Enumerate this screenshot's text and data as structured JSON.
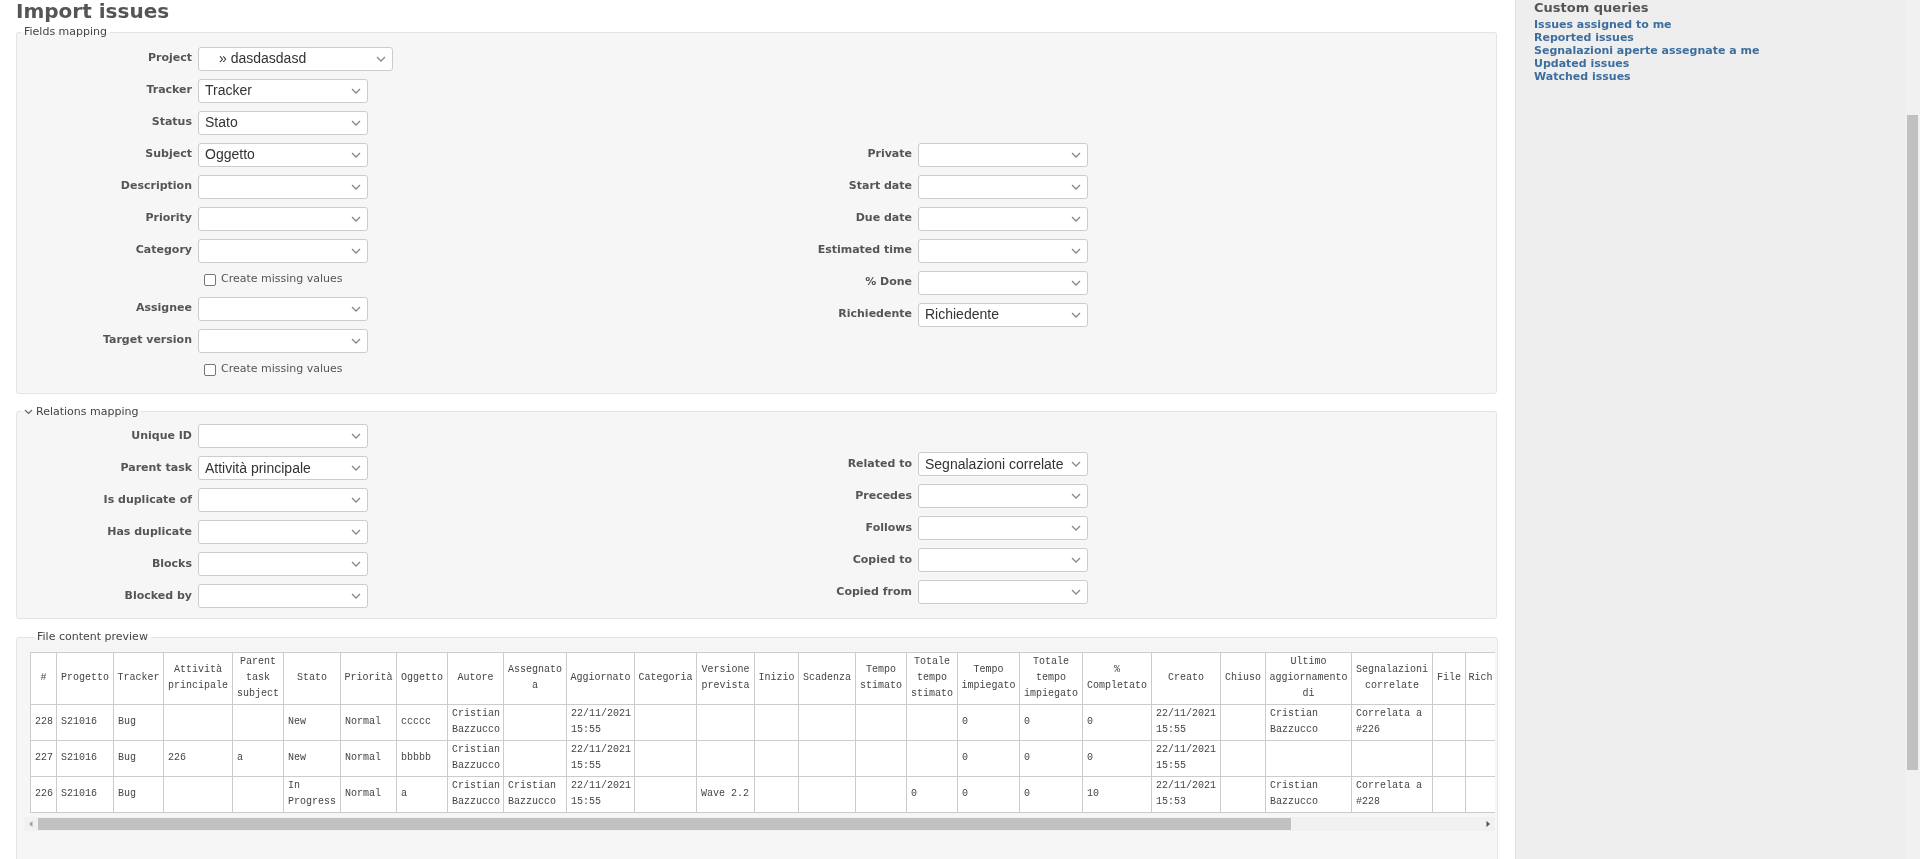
{
  "page_title": "Import issues",
  "fields_mapping": {
    "legend": "Fields mapping",
    "left": [
      {
        "kind": "select",
        "label": "Project",
        "value": "» dasdasdasd"
      },
      {
        "kind": "select",
        "label": "Tracker",
        "value": "Tracker"
      },
      {
        "kind": "select",
        "label": "Status",
        "value": "Stato"
      },
      {
        "kind": "select",
        "label": "Subject",
        "value": "Oggetto"
      },
      {
        "kind": "select",
        "label": "Description"
      },
      {
        "kind": "select",
        "label": "Priority"
      },
      {
        "kind": "select",
        "label": "Category"
      },
      {
        "kind": "checkbox",
        "label": "Create missing values",
        "checked": false
      },
      {
        "kind": "select",
        "label": "Assignee"
      },
      {
        "kind": "select",
        "label": "Target version"
      },
      {
        "kind": "checkbox",
        "label": "Create missing values",
        "checked": false
      }
    ],
    "right": [
      {
        "kind": "select",
        "label": "Private"
      },
      {
        "kind": "select",
        "label": "Start date"
      },
      {
        "kind": "select",
        "label": "Due date"
      },
      {
        "kind": "select",
        "label": "Estimated time"
      },
      {
        "kind": "select",
        "label": "% Done"
      },
      {
        "kind": "select",
        "label": "Richiedente",
        "value": "Richiedente"
      }
    ]
  },
  "relations_mapping": {
    "legend": "Relations mapping",
    "expanded": true,
    "left": [
      {
        "kind": "select",
        "label": "Unique ID"
      },
      {
        "kind": "select",
        "label": "Parent task",
        "value": "Attività principale"
      },
      {
        "kind": "select",
        "label": "Is duplicate of"
      },
      {
        "kind": "select",
        "label": "Has duplicate"
      },
      {
        "kind": "select",
        "label": "Blocks"
      },
      {
        "kind": "select",
        "label": "Blocked by"
      }
    ],
    "right": [
      {
        "kind": "select",
        "label": "Related to",
        "value": "Segnalazioni correlate"
      },
      {
        "kind": "select",
        "label": "Precedes"
      },
      {
        "kind": "select",
        "label": "Follows"
      },
      {
        "kind": "select",
        "label": "Copied to"
      },
      {
        "kind": "select",
        "label": "Copied from"
      }
    ]
  },
  "file_preview": {
    "legend": "File content preview",
    "columns": [
      "#",
      "Progetto",
      "Tracker",
      "Attività principale",
      "Parent task subject",
      "Stato",
      "Priorità",
      "Oggetto",
      "Autore",
      "Assegnato a",
      "Aggiornato",
      "Categoria",
      "Versione prevista",
      "Inizio",
      "Scadenza",
      "Tempo stimato",
      "Totale tempo stimato",
      "Tempo impiegato",
      "Totale tempo impiegato",
      "% Completato",
      "Creato",
      "Chiuso",
      "Ultimo aggiornamento di",
      "Segnalazioni correlate",
      "File",
      "Rich"
    ],
    "rows": [
      [
        "228",
        "S21016",
        "Bug",
        "",
        "",
        "New",
        "Normal",
        "ccccc",
        "Cristian Bazzucco",
        "",
        "22/11/2021 15:55",
        "",
        "",
        "",
        "",
        "",
        "",
        "0",
        "0",
        "0",
        "22/11/2021 15:55",
        "",
        "Cristian Bazzucco",
        "Correlata a #226",
        "",
        ""
      ],
      [
        "227",
        "S21016",
        "Bug",
        "226",
        "a",
        "New",
        "Normal",
        "bbbbb",
        "Cristian Bazzucco",
        "",
        "22/11/2021 15:55",
        "",
        "",
        "",
        "",
        "",
        "",
        "0",
        "0",
        "0",
        "22/11/2021 15:55",
        "",
        "",
        "",
        "",
        ""
      ],
      [
        "226",
        "S21016",
        "Bug",
        "",
        "",
        "In Progress",
        "Normal",
        "a",
        "Cristian Bazzucco",
        "Cristian Bazzucco",
        "22/11/2021 15:55",
        "",
        "Wave 2.2",
        "",
        "",
        "",
        "0",
        "0",
        "0",
        "10",
        "22/11/2021 15:53",
        "",
        "Cristian Bazzucco",
        "Correlata a #228",
        "",
        ""
      ]
    ]
  },
  "sidebar": {
    "heading": "Custom queries",
    "links": [
      "Issues assigned to me",
      "Reported issues",
      "Segnalazioni aperte assegnate a me",
      "Updated issues",
      "Watched issues"
    ]
  }
}
